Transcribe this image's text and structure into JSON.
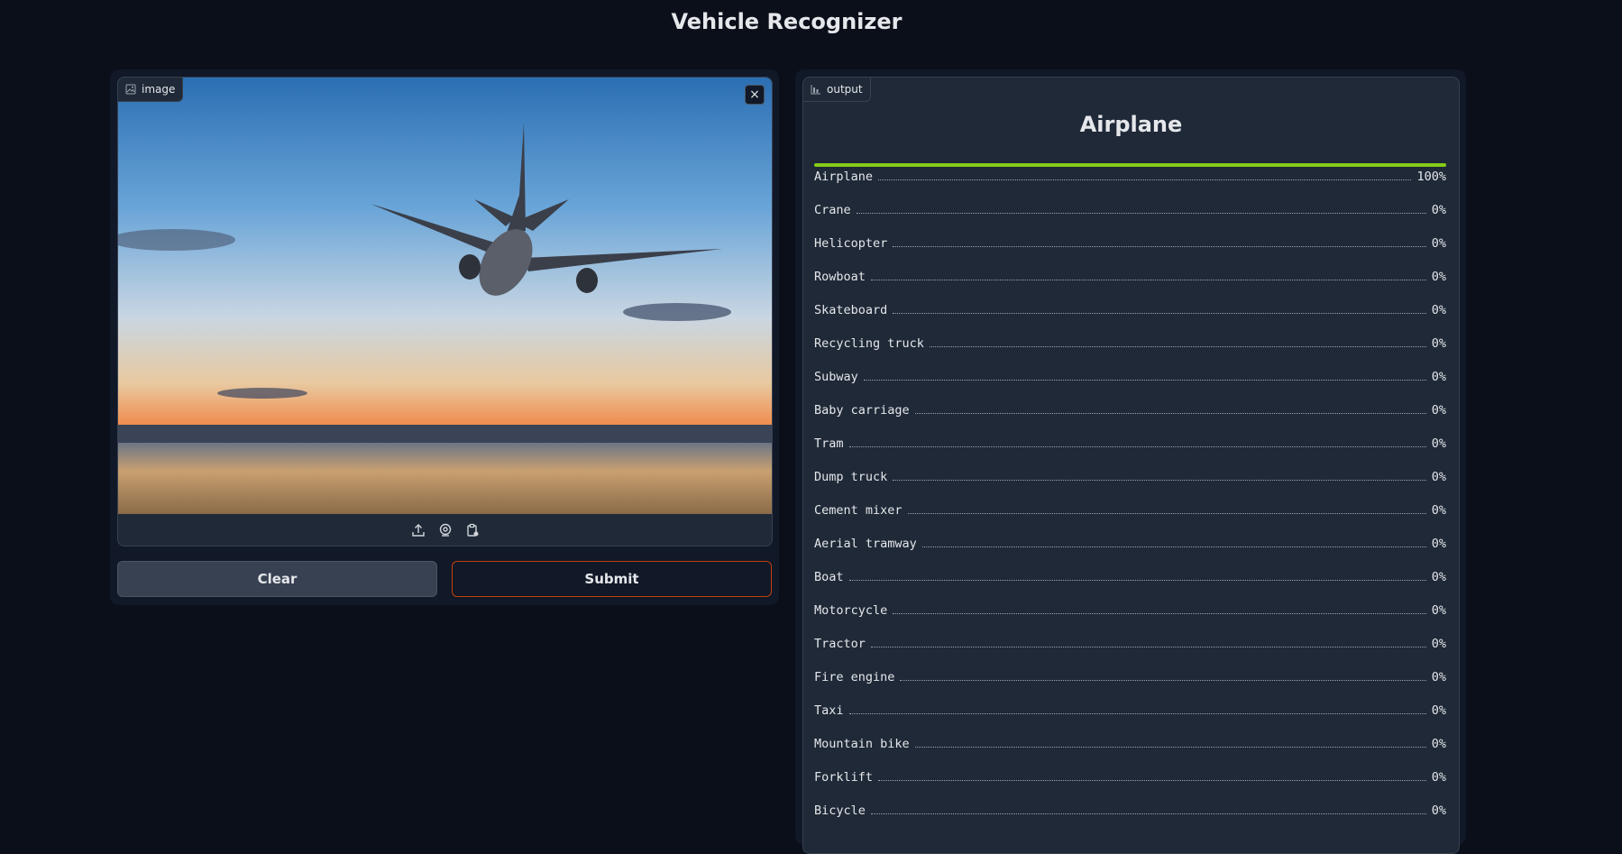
{
  "app": {
    "title": "Vehicle Recognizer"
  },
  "input": {
    "label": "image",
    "close_glyph": "×",
    "source_icons": [
      "upload-icon",
      "webcam-icon",
      "clipboard-icon"
    ]
  },
  "buttons": {
    "clear": "Clear",
    "submit": "Submit"
  },
  "output": {
    "label": "output",
    "top_label": "Airplane",
    "top_confidence": 1.0,
    "bar_color": "#84cc16",
    "confidences": [
      {
        "name": "Airplane",
        "pct": "100%"
      },
      {
        "name": "Crane",
        "pct": "0%"
      },
      {
        "name": "Helicopter",
        "pct": "0%"
      },
      {
        "name": "Rowboat",
        "pct": "0%"
      },
      {
        "name": "Skateboard",
        "pct": "0%"
      },
      {
        "name": "Recycling truck",
        "pct": "0%"
      },
      {
        "name": "Subway",
        "pct": "0%"
      },
      {
        "name": "Baby carriage",
        "pct": "0%"
      },
      {
        "name": "Tram",
        "pct": "0%"
      },
      {
        "name": "Dump truck",
        "pct": "0%"
      },
      {
        "name": "Cement mixer",
        "pct": "0%"
      },
      {
        "name": "Aerial tramway",
        "pct": "0%"
      },
      {
        "name": "Boat",
        "pct": "0%"
      },
      {
        "name": "Motorcycle",
        "pct": "0%"
      },
      {
        "name": "Tractor",
        "pct": "0%"
      },
      {
        "name": "Fire engine",
        "pct": "0%"
      },
      {
        "name": "Taxi",
        "pct": "0%"
      },
      {
        "name": "Mountain bike",
        "pct": "0%"
      },
      {
        "name": "Forklift",
        "pct": "0%"
      },
      {
        "name": "Bicycle",
        "pct": "0%"
      }
    ]
  }
}
